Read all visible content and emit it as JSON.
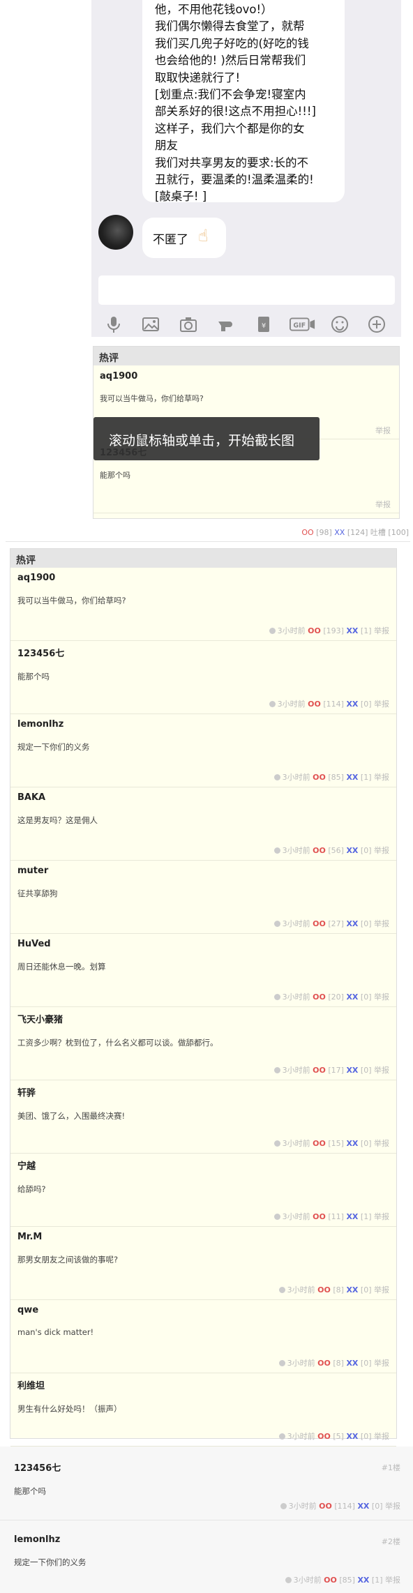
{
  "chat": {
    "lines": [
      "他，不用他花钱ovo!）",
      "我们偶尔懒得去食堂了，就帮",
      "我们买几兜子好吃的(好吃的钱",
      "也会给他的! )然后日常帮我们",
      "取取快递就行了!",
      "[划重点:我们不会争宠!寝室内",
      "部关系好的很!这点不用担心!!!]",
      "这样子，我们六个都是你的女",
      "朋友",
      "我们对共享男友的要求:长的不",
      "丑就行，要温柔的!温柔温柔的!",
      "[敲桌子! ]"
    ],
    "reply": "不匿了",
    "reply_emoji": "☝",
    "toolbar_icons": [
      "microphone-icon",
      "image-icon",
      "camera-icon",
      "red-packet-hand-icon",
      "money-envelope-icon",
      "gif-icon",
      "emoji-icon",
      "plus-icon"
    ]
  },
  "mini_hot": {
    "title": "热评",
    "items": [
      {
        "author": "aq1900",
        "text": "我可以当牛做马，你们给草吗?",
        "report": "举报"
      },
      {
        "author": "123456七",
        "text": "能那个吗",
        "report": "举报"
      }
    ],
    "stats": {
      "oo_label": "OO",
      "oo_count": "[98]",
      "xx_label": "XX",
      "xx_count": "[124]",
      "tucao": "吐槽 [100]"
    }
  },
  "tooltip": "滚动鼠标轴或单击，开始截长图",
  "hot": {
    "title": "热评",
    "items": [
      {
        "author": "aq1900",
        "text": "我可以当牛做马，你们给草吗?",
        "time": "3小时前",
        "oo": "[193]",
        "xx": "[1]"
      },
      {
        "author": "123456七",
        "text": "能那个吗",
        "time": "3小时前",
        "oo": "[114]",
        "xx": "[0]"
      },
      {
        "author": "lemonlhz",
        "text": "规定一下你们的义务",
        "time": "3小时前",
        "oo": "[85]",
        "xx": "[1]"
      },
      {
        "author": "BAKA",
        "text": "这是男友吗？这是佣人",
        "time": "3小时前",
        "oo": "[56]",
        "xx": "[0]"
      },
      {
        "author": "muter",
        "text": "征共享舔狗",
        "time": "3小时前",
        "oo": "[27]",
        "xx": "[0]"
      },
      {
        "author": "HuVed",
        "text": "周日还能休息一晚。划算",
        "time": "3小时前",
        "oo": "[20]",
        "xx": "[0]"
      },
      {
        "author": "飞天小豪猪",
        "text": "工资多少啊？枕到位了，什么名义都可以谈。做舔都行。",
        "time": "3小时前",
        "oo": "[17]",
        "xx": "[0]"
      },
      {
        "author": "轩骅",
        "text": "美团、饿了么，入围最终决赛!",
        "time": "3小时前",
        "oo": "[15]",
        "xx": "[0]"
      },
      {
        "author": "宁越",
        "text": "给舔吗?",
        "time": "3小时前",
        "oo": "[11]",
        "xx": "[1]"
      },
      {
        "author": "Mr.M",
        "text": "那男女朋友之间该做的事呢?",
        "time": "3小时前",
        "oo": "[8]",
        "xx": "[0]"
      },
      {
        "author": "qwe",
        "text": "man's dick matter!",
        "time": "3小时前",
        "oo": "[8]",
        "xx": "[0]"
      },
      {
        "author": "利维坦",
        "text": "男生有什么好处吗！（振声）",
        "time": "3小时前",
        "oo": "[5]",
        "xx": "[0]"
      }
    ],
    "oo_label": "OO",
    "xx_label": "XX",
    "report": "举报"
  },
  "normal": {
    "items": [
      {
        "author": "123456七",
        "floor": "#1楼",
        "text": "能那个吗",
        "time": "3小时前",
        "oo": "[114]",
        "xx": "[0]"
      },
      {
        "author": "lemonlhz",
        "floor": "#2楼",
        "text": "规定一下你们的义务",
        "time": "3小时前",
        "oo": "[85]",
        "xx": "[1]"
      }
    ]
  }
}
